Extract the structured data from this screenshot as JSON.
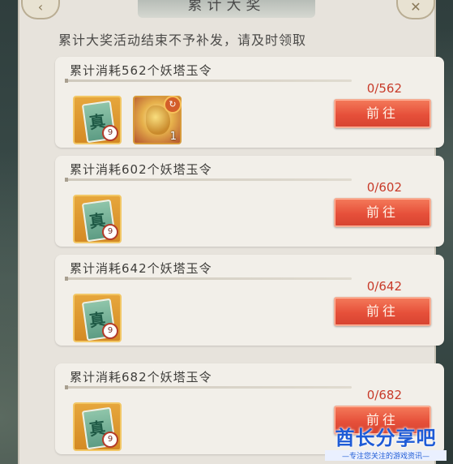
{
  "header": {
    "title": "累计大奖",
    "back_icon": "back-arrow-icon",
    "close_icon": "close-icon"
  },
  "notice": "累计大奖活动结束不予补发，请及时领取",
  "cards": [
    {
      "title": "累计消耗562个妖塔玉令",
      "progress": "0/562",
      "button": "前往",
      "items": [
        {
          "kind": "jade",
          "glyph": "真",
          "badge": "9"
        },
        {
          "kind": "gold",
          "qty": "1"
        }
      ]
    },
    {
      "title": "累计消耗602个妖塔玉令",
      "progress": "0/602",
      "button": "前往",
      "items": [
        {
          "kind": "jade",
          "glyph": "真",
          "badge": "9"
        }
      ]
    },
    {
      "title": "累计消耗642个妖塔玉令",
      "progress": "0/642",
      "button": "前往",
      "items": [
        {
          "kind": "jade",
          "glyph": "真",
          "badge": "9"
        }
      ]
    },
    {
      "title": "累计消耗682个妖塔玉令",
      "progress": "0/682",
      "button": "前往",
      "items": [
        {
          "kind": "jade",
          "glyph": "真",
          "badge": "9"
        }
      ]
    }
  ],
  "watermark": {
    "main": "酋长分享吧",
    "sub": "—专注您关注的游戏资讯—"
  }
}
